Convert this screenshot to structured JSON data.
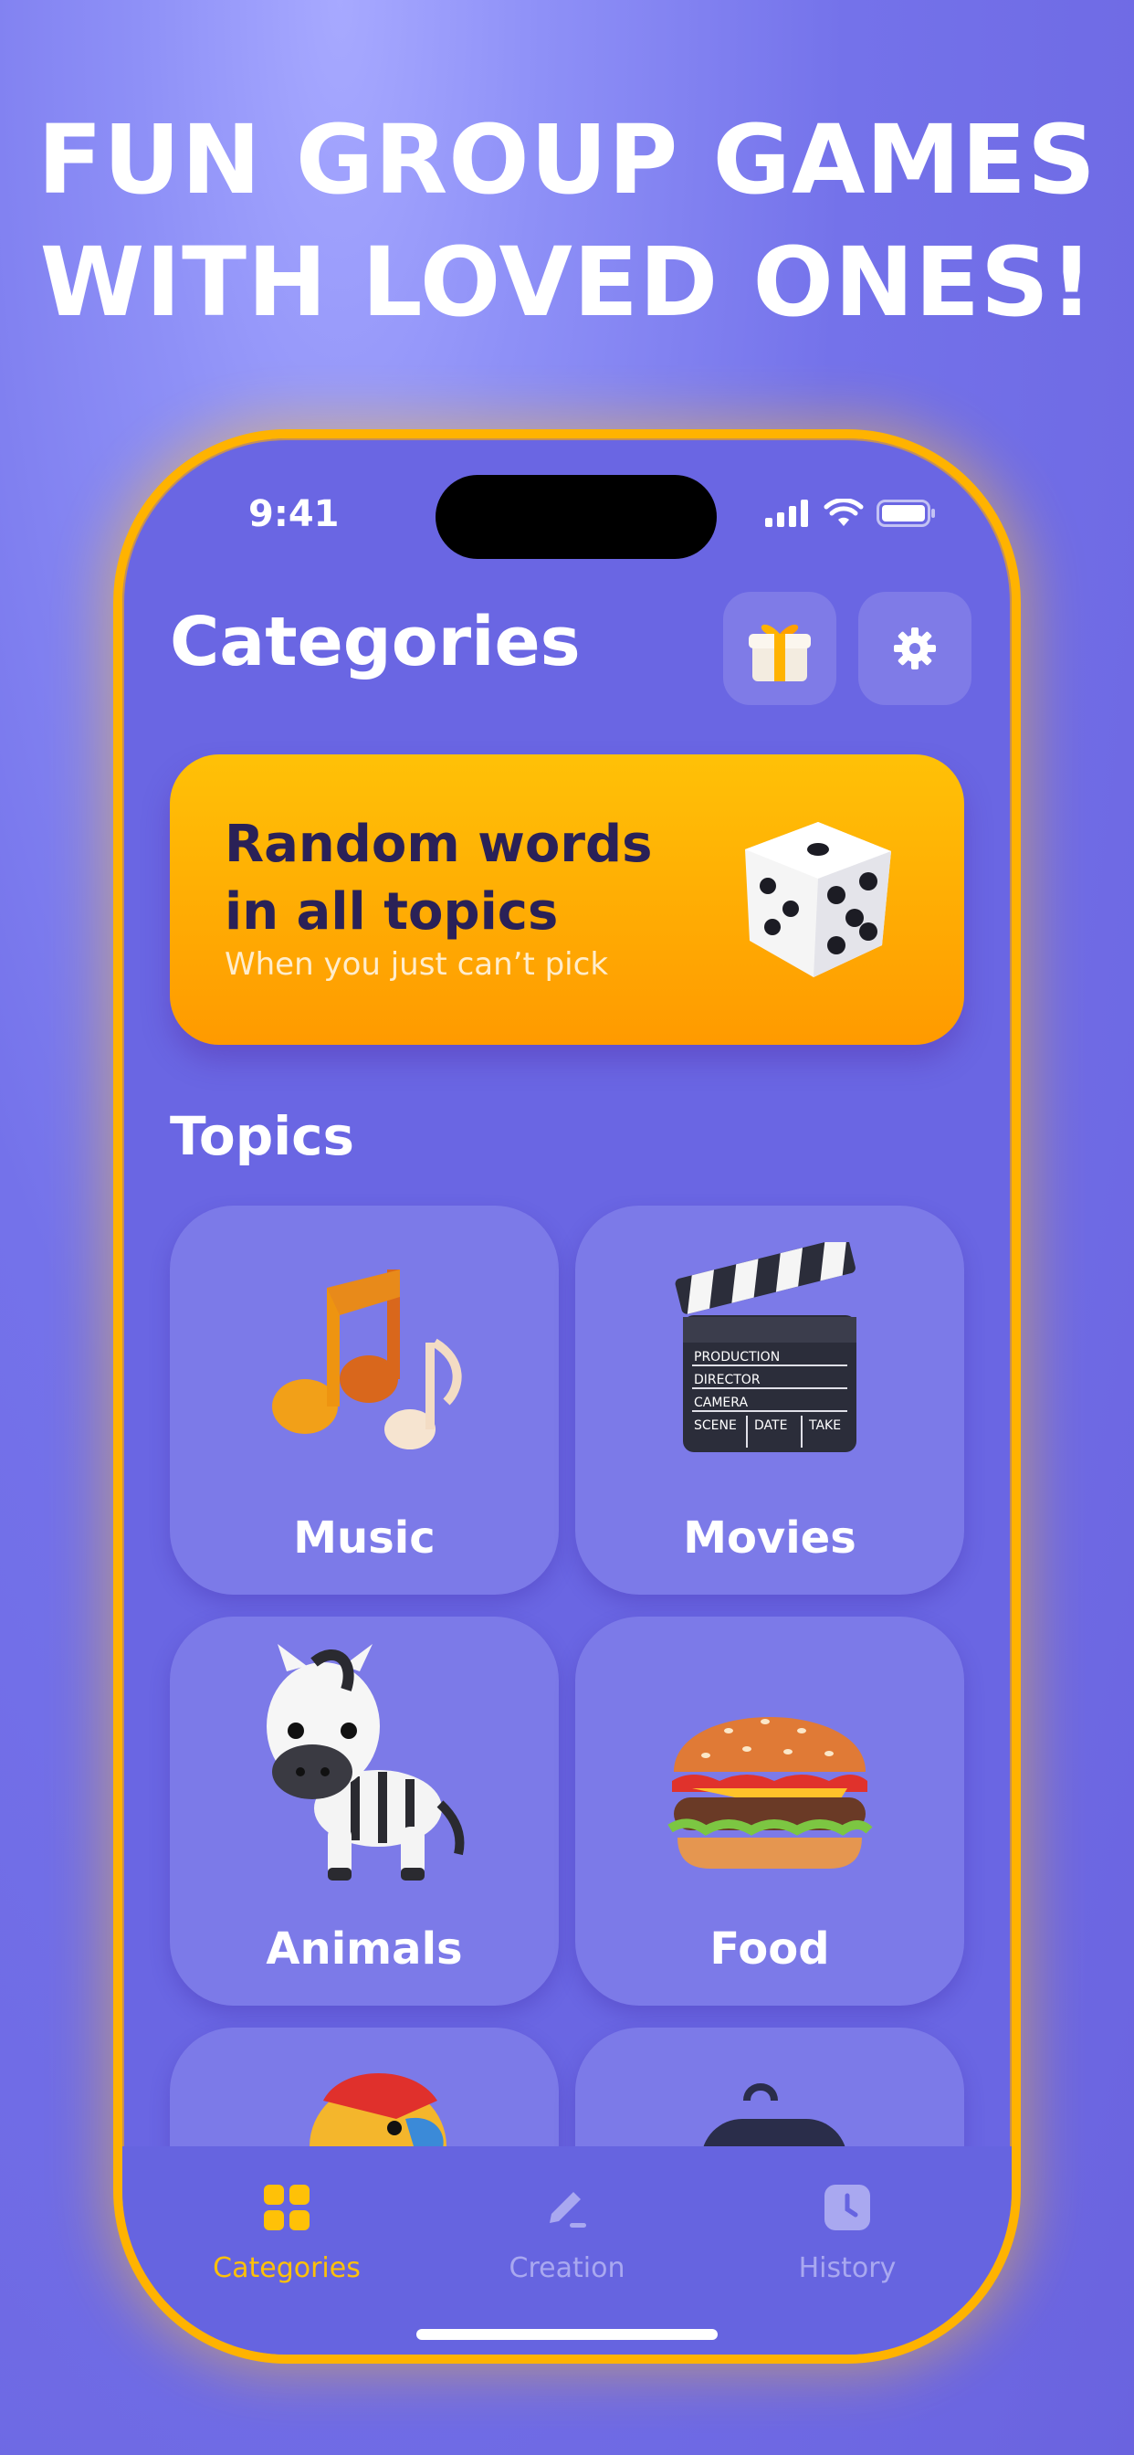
{
  "headline": {
    "line1": "FUN GROUP GAMES",
    "line2": "WITH LOVED ONES!"
  },
  "status_bar": {
    "time": "9:41"
  },
  "header": {
    "title": "Categories",
    "gift_icon": "gift-icon",
    "settings_icon": "gear-icon"
  },
  "banner": {
    "title_line1": "Random words",
    "title_line2": "in all topics",
    "subtitle": "When you just can’t pick",
    "icon": "dice-icon"
  },
  "topics": {
    "title": "Topics",
    "items": [
      {
        "label": "Music",
        "icon": "music-notes-icon"
      },
      {
        "label": "Movies",
        "icon": "clapperboard-icon"
      },
      {
        "label": "Animals",
        "icon": "zebra-icon"
      },
      {
        "label": "Food",
        "icon": "burger-icon"
      },
      {
        "label": "",
        "icon": "parrot-icon"
      },
      {
        "label": "",
        "icon": "gamepad-icon"
      }
    ]
  },
  "clapperboard_text": {
    "production": "PRODUCTION",
    "director": "DIRECTOR",
    "camera": "CAMERA",
    "scene": "SCENE",
    "date": "DATE",
    "take": "TAKE"
  },
  "tab_bar": {
    "tabs": [
      {
        "label": "Categories",
        "icon": "grid-icon",
        "active": true
      },
      {
        "label": "Creation",
        "icon": "pencil-icon",
        "active": false
      },
      {
        "label": "History",
        "icon": "clock-icon",
        "active": false
      }
    ]
  },
  "colors": {
    "accent": "#ffc107",
    "banner_text": "#2a2157",
    "background": "#6a66e3",
    "card": "#7c7ae8"
  }
}
